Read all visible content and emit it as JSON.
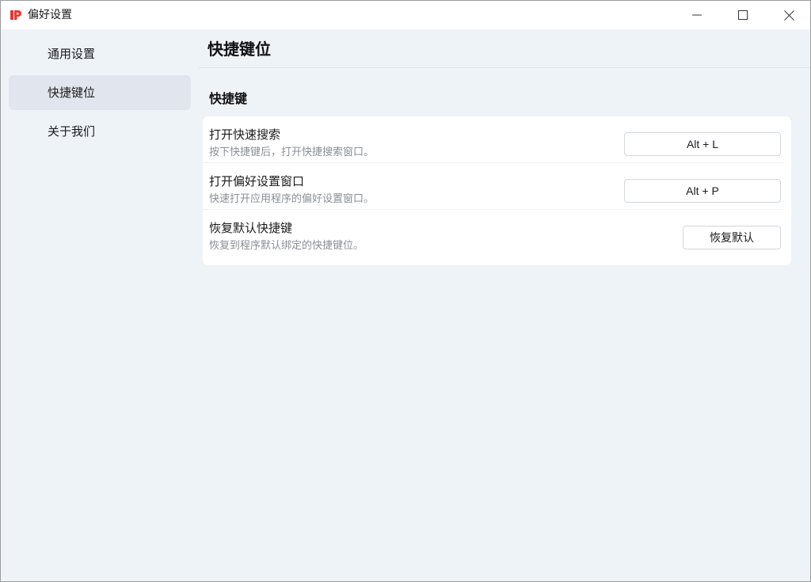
{
  "window": {
    "title": "偏好设置",
    "icons": {
      "app": "app-logo-icon",
      "minimize": "minimize-icon",
      "maximize": "maximize-icon",
      "close": "close-icon"
    }
  },
  "sidebar": {
    "items": [
      {
        "label": "通用设置",
        "active": false
      },
      {
        "label": "快捷键位",
        "active": true
      },
      {
        "label": "关于我们",
        "active": false
      }
    ]
  },
  "main": {
    "title": "快捷键位",
    "section_title": "快捷键",
    "rows": [
      {
        "title": "打开快速搜索",
        "description": "按下快捷键后，打开快捷搜索窗口。",
        "button": "Alt + L"
      },
      {
        "title": "打开偏好设置窗口",
        "description": "快速打开应用程序的偏好设置窗口。",
        "button": "Alt + P"
      },
      {
        "title": "恢复默认快捷键",
        "description": "恢复到程序默认绑定的快捷键位。",
        "button": "恢复默认"
      }
    ]
  },
  "colors": {
    "background": "#eef3f8",
    "card": "#ffffff",
    "active_nav": "#e1e6ee",
    "logo": "#e53935"
  }
}
